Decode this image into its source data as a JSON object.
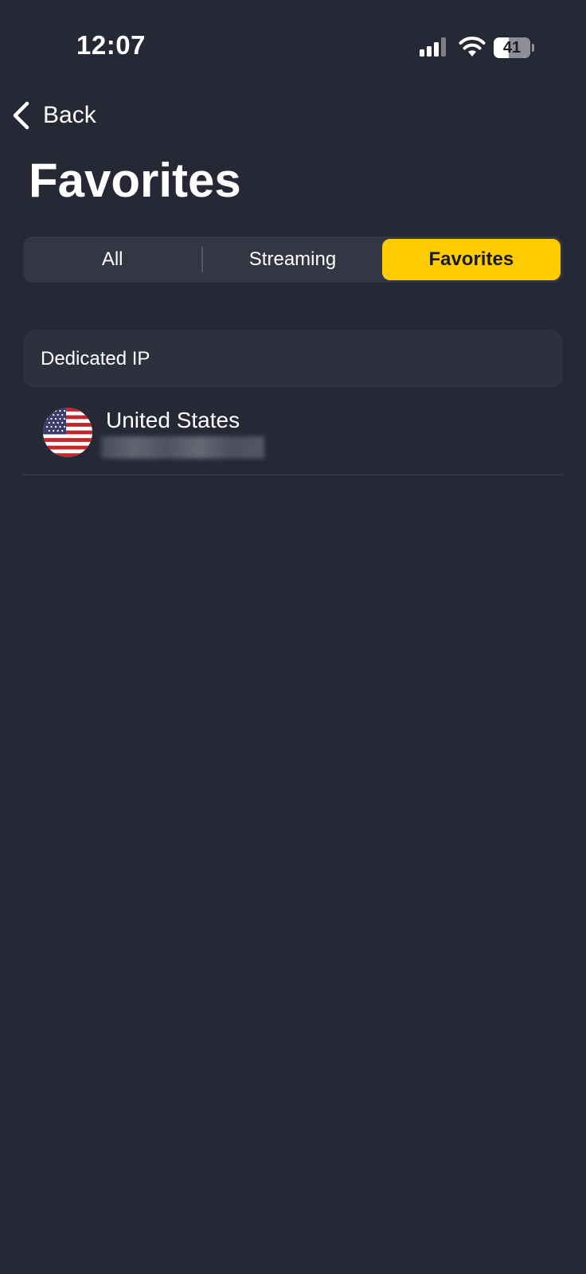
{
  "status_bar": {
    "time": "12:07",
    "battery_level": "41",
    "battery_fraction": 0.41
  },
  "nav": {
    "back_label": "Back"
  },
  "page": {
    "title": "Favorites"
  },
  "tabs": [
    {
      "label": "All",
      "active": false
    },
    {
      "label": "Streaming",
      "active": false
    },
    {
      "label": "Favorites",
      "active": true
    }
  ],
  "section": {
    "title": "Dedicated IP"
  },
  "servers": [
    {
      "country": "United States",
      "flag": "us-flag-icon",
      "ip_redacted": true
    }
  ],
  "colors": {
    "background": "#262835",
    "accent": "#ffcc00",
    "segment_background": "#343643",
    "section_background": "#2e303e"
  }
}
